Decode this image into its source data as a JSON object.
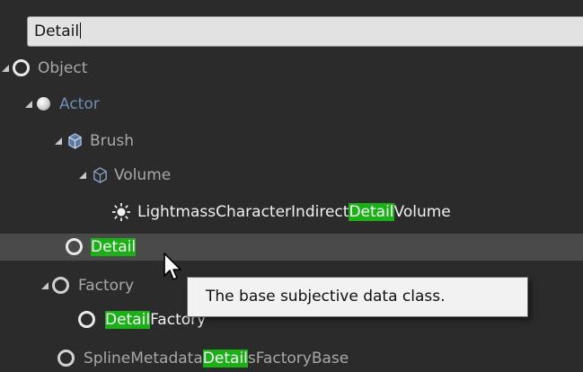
{
  "search": {
    "value": "Detail"
  },
  "tree": {
    "object": {
      "label": "Object"
    },
    "actor": {
      "label": "Actor"
    },
    "brush": {
      "label": "Brush"
    },
    "volume": {
      "label": "Volume"
    },
    "lightmass": {
      "pre": "LightmassCharacterIndirect",
      "match": "Detail",
      "post": "Volume"
    },
    "detail": {
      "match": "Detail"
    },
    "factory": {
      "label": "Factory"
    },
    "detail_factory": {
      "match": "Detail",
      "post": "Factory"
    },
    "spline": {
      "pre": "SplineMetadata",
      "match": "Detail",
      "post": "sFactoryBase"
    }
  },
  "tooltip": {
    "text": "The base subjective data class."
  },
  "icons": {
    "expand": "expand-arrow-icon",
    "class": "class-ring-icon",
    "actor": "sphere-icon",
    "brush": "brush-cube-icon",
    "volume": "volume-cube-icon",
    "light": "light-sun-icon",
    "cursor": "mouse-pointer-icon"
  },
  "colors": {
    "highlight": "#18b215",
    "actor_text": "#6d8fb0",
    "selected_row": "#4a4a4a"
  }
}
